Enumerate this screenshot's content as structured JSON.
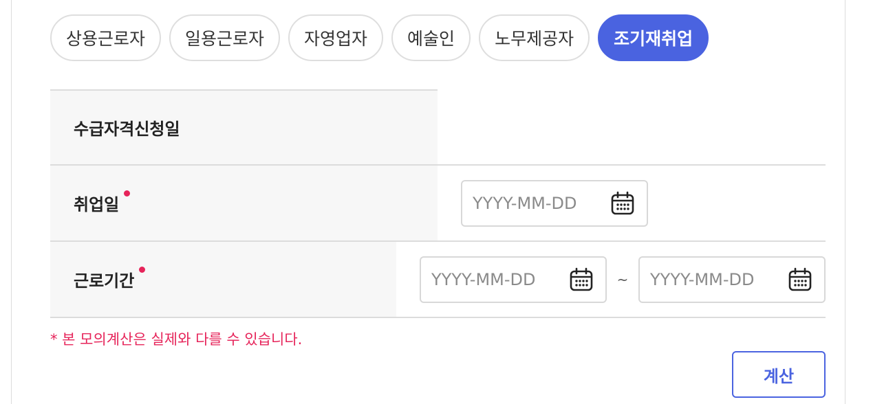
{
  "tabs": [
    {
      "label": "상용근로자",
      "active": false
    },
    {
      "label": "일용근로자",
      "active": false
    },
    {
      "label": "자영업자",
      "active": false
    },
    {
      "label": "예술인",
      "active": false
    },
    {
      "label": "노무제공자",
      "active": false
    },
    {
      "label": "조기재취업",
      "active": true
    }
  ],
  "form": {
    "application_date": {
      "label": "수급자격신청일"
    },
    "employment_date": {
      "label": "취업일",
      "required": true,
      "placeholder": "YYYY-MM-DD",
      "value": ""
    },
    "work_period": {
      "label": "근로기간",
      "required": true,
      "start": {
        "placeholder": "YYYY-MM-DD",
        "value": ""
      },
      "separator": "~",
      "end": {
        "placeholder": "YYYY-MM-DD",
        "value": ""
      }
    }
  },
  "notice": "* 본 모의계산은 실제와 다를 수 있습니다.",
  "calculate_button": "계산",
  "colors": {
    "accent": "#4a63e0",
    "required": "#e6245a",
    "label_bg": "#f7f7f7"
  },
  "icons": {
    "date_picker": "calendar-icon"
  }
}
